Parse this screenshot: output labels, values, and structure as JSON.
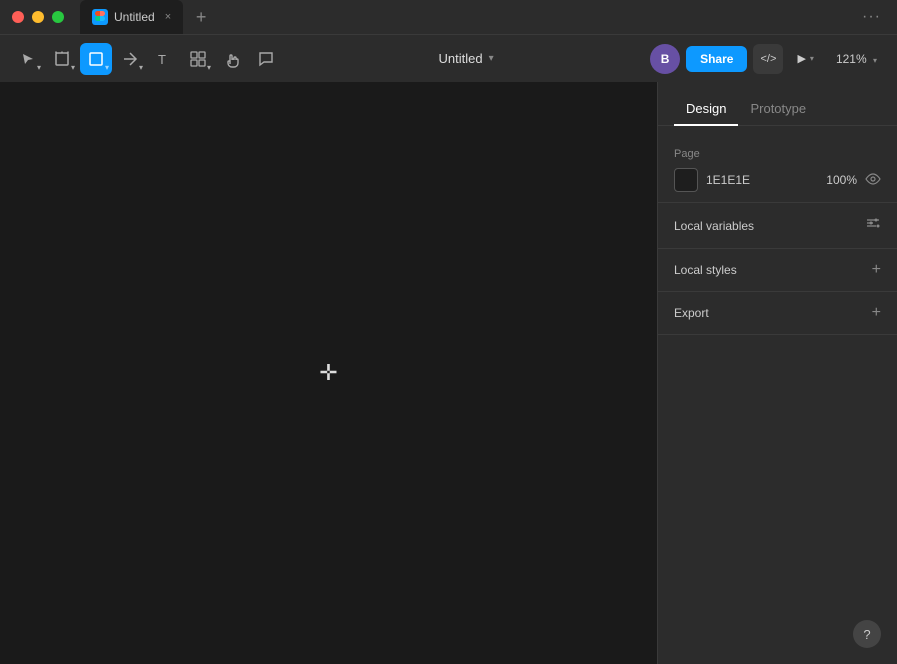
{
  "titlebar": {
    "traffic_lights": [
      "close",
      "minimize",
      "maximize"
    ],
    "tab": {
      "label": "Untitled",
      "icon_letter": "F",
      "close": "×"
    },
    "new_tab": "+",
    "more": "···"
  },
  "toolbar": {
    "tools": [
      {
        "id": "move",
        "label": "Move",
        "icon": "move"
      },
      {
        "id": "select",
        "label": "Select",
        "icon": "arrow"
      },
      {
        "id": "frame",
        "label": "Frame",
        "icon": "frame"
      },
      {
        "id": "shape",
        "label": "Shape",
        "icon": "rect",
        "active": true
      },
      {
        "id": "pen",
        "label": "Pen",
        "icon": "pen"
      },
      {
        "id": "text",
        "label": "Text",
        "icon": "text"
      },
      {
        "id": "components",
        "label": "Components",
        "icon": "components"
      },
      {
        "id": "hand",
        "label": "Hand",
        "icon": "hand"
      },
      {
        "id": "comment",
        "label": "Comment",
        "icon": "comment"
      }
    ],
    "title": "Untitled",
    "title_caret": "▾",
    "right": {
      "avatar_label": "B",
      "share_label": "Share",
      "code_label": "</>",
      "play_icon": "▶",
      "zoom_label": "121%",
      "zoom_caret": "▾"
    }
  },
  "canvas": {
    "cursor": "✛"
  },
  "right_panel": {
    "tabs": [
      {
        "id": "design",
        "label": "Design",
        "active": true
      },
      {
        "id": "prototype",
        "label": "Prototype",
        "active": false
      }
    ],
    "page_section": {
      "label": "Page",
      "color_hex": "1E1E1E",
      "opacity": "100%"
    },
    "local_variables": {
      "label": "Local variables"
    },
    "local_styles": {
      "label": "Local styles",
      "add": "+"
    },
    "export": {
      "label": "Export",
      "add": "+"
    }
  },
  "help": {
    "label": "?"
  }
}
